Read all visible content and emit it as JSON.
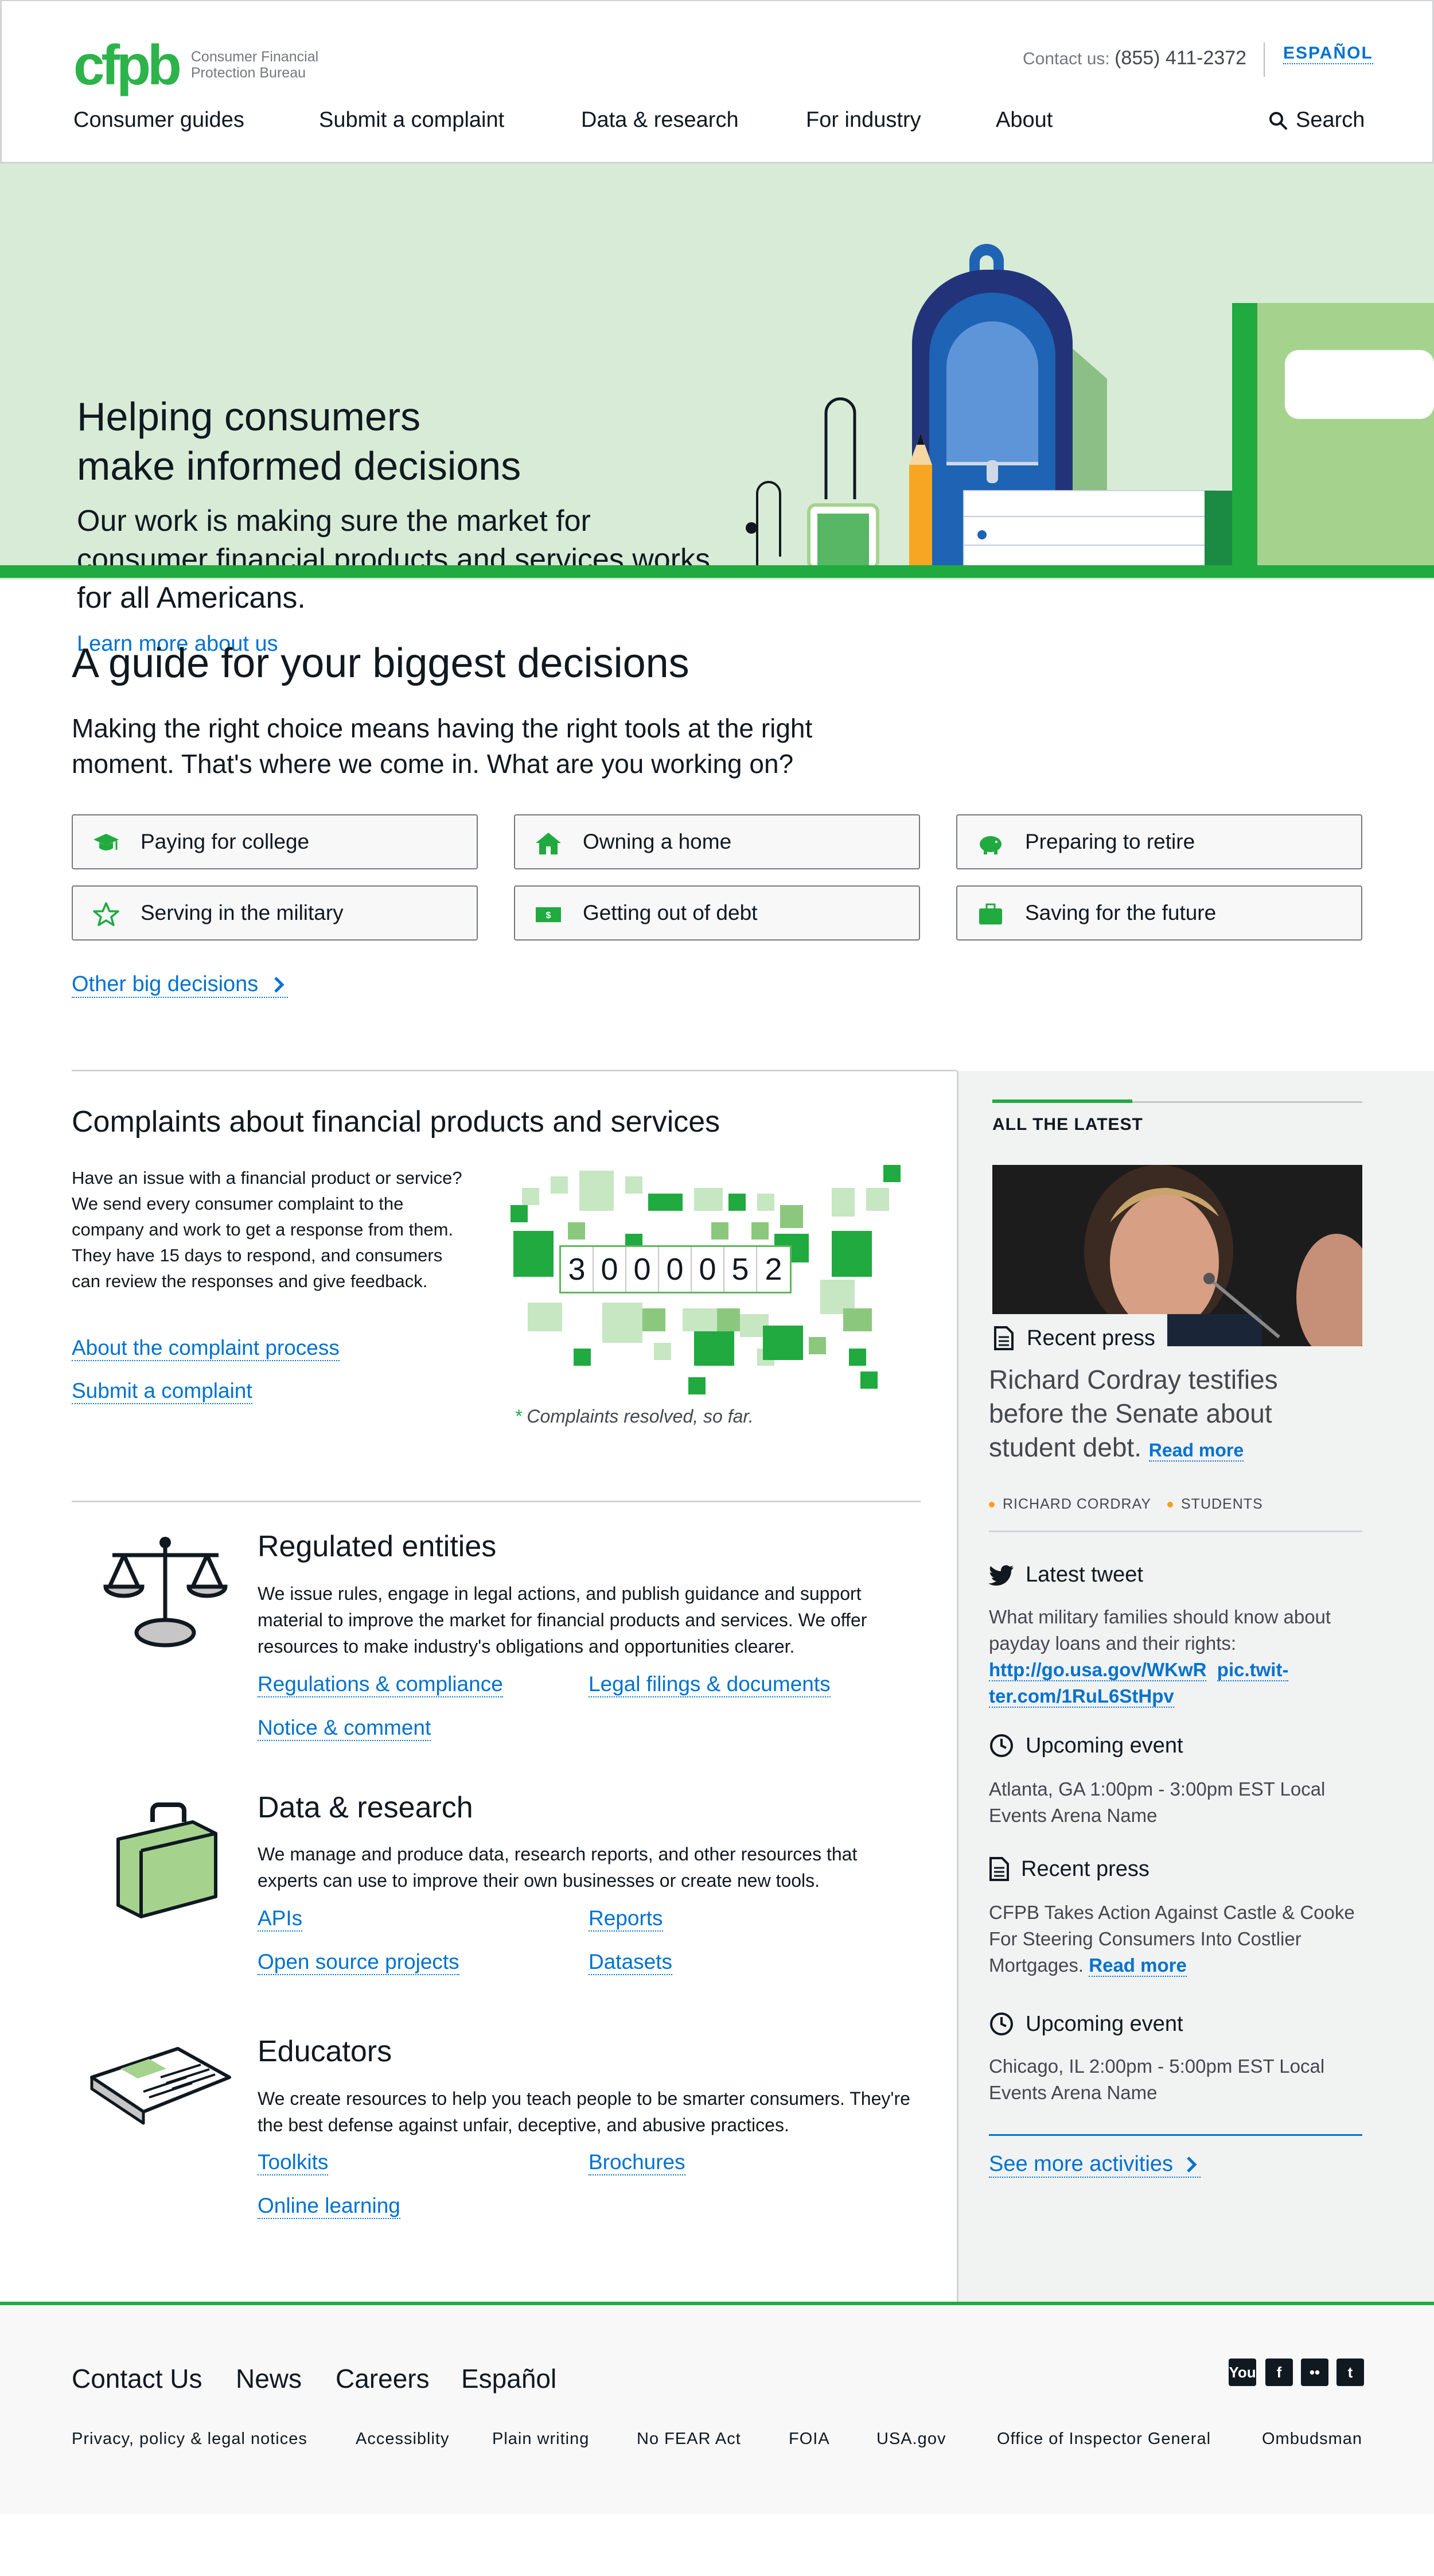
{
  "header": {
    "logo_mark": "cfpb",
    "logo_text_line1": "Consumer Financial",
    "logo_text_line2": "Protection Bureau",
    "contact_label": "Contact us:",
    "contact_number": "(855) 411-2372",
    "espanol": "ESPAÑOL",
    "nav": [
      "Consumer guides",
      "Submit a complaint",
      "Data & research",
      "For industry",
      "About"
    ],
    "search_label": "Search"
  },
  "hero": {
    "title_line1": "Helping consumers",
    "title_line2": "make informed decisions",
    "subtitle": "Our work is making sure the market for consumer financial products and services works for all Americans.",
    "link": "Learn more about us"
  },
  "guide": {
    "title": "A guide for your biggest decisions",
    "subtitle": "Making the right choice means having the right tools at the right moment. That's where we come in. What are you working on?",
    "buttons": [
      {
        "label": "Paying for college",
        "icon": "graduation-cap-icon"
      },
      {
        "label": "Owning a home",
        "icon": "house-icon"
      },
      {
        "label": "Preparing to retire",
        "icon": "piggy-bank-icon"
      },
      {
        "label": "Serving in the military",
        "icon": "star-icon"
      },
      {
        "label": "Getting out of debt",
        "icon": "dollar-bill-icon"
      },
      {
        "label": "Saving for the future",
        "icon": "briefcase-icon"
      }
    ],
    "other_link": "Other big decisions"
  },
  "complaints": {
    "title": "Complaints about financial products and services",
    "text": "Have an issue with a financial product or service? We send every consumer complaint to the company and work to get a response from them. They have 15 days to respond, and consumers can review the responses and give feedback.",
    "link1": "About the complaint process",
    "link2": "Submit a complaint",
    "counter_digits": [
      "3",
      "0",
      "0",
      "0",
      "0",
      "5",
      "2"
    ],
    "counter_note_asterisk": "*",
    "counter_note": "Complaints resolved, so far."
  },
  "regulated": {
    "title": "Regulated entities",
    "text": "We issue rules, engage in legal actions, and publish guidance and support material to improve the market for financial products and services. We offer resources to make industry's obligations and opportunities clearer.",
    "links": [
      "Regulations & compliance",
      "Legal filings & documents",
      "Notice & comment"
    ]
  },
  "data_research": {
    "title": "Data & research",
    "text": "We manage and produce data, research reports, and other resources that experts can use to improve their own businesses or create new tools.",
    "links": [
      "APIs",
      "Reports",
      "Open source projects",
      "Datasets"
    ]
  },
  "educators": {
    "title": "Educators",
    "text": "We create resources to help you teach people to be smarter consumers. They're the best defense against unfair, deceptive, and abusive practices.",
    "links": [
      "Toolkits",
      "Brochures",
      "Online learning"
    ]
  },
  "latest": {
    "title": "ALL THE LATEST",
    "press_tag": "Recent press",
    "press_headline": "Richard Cordray testifies before the Senate about student debt.",
    "press_read_more": "Read more",
    "tags": [
      "RICHARD CORDRAY",
      "STUDENTS"
    ],
    "tweet_heading": "Latest tweet",
    "tweet_text": "What military families should know about payday loans and their rights:",
    "tweet_link1": "http://go.usa.gov/WKwR",
    "tweet_link2": "pic.twit-",
    "tweet_link3": "ter.com/1RuL6StHpv",
    "event1_heading": "Upcoming event",
    "event1_line1": "Atlanta, GA 1:00pm - 3:00pm EST Local",
    "event1_line2": "Events Arena Name",
    "press2_heading": "Recent press",
    "press2_text": "CFPB Takes Action Against Castle & Cooke For Steering Consumers Into Costlier Mortgages.",
    "press2_read_more": "Read more",
    "event2_heading": "Upcoming event",
    "event2_line1": "Chicago, IL 2:00pm - 5:00pm EST Local",
    "event2_line2": "Events Arena Name",
    "see_more": "See more activities"
  },
  "footer": {
    "main_links": [
      "Contact Us",
      "News",
      "Careers",
      "Español"
    ],
    "small_links": [
      "Privacy, policy & legal notices",
      "Accessiblity",
      "Plain writing",
      "No FEAR Act",
      "FOIA",
      "USA.gov",
      "Office of Inspector General",
      "Ombudsman"
    ],
    "social": [
      {
        "icon": "youtube-icon",
        "glyph": "You"
      },
      {
        "icon": "facebook-icon",
        "glyph": "f"
      },
      {
        "icon": "flickr-icon",
        "glyph": "••"
      },
      {
        "icon": "twitter-icon",
        "glyph": "t"
      }
    ]
  },
  "colors": {
    "brand_green": "#20aa3f",
    "link_blue": "#0072ce",
    "hero_bg": "#d8ebd6",
    "sidebar_bg": "#f1f2f2",
    "tag_orange": "#ff9e1b"
  }
}
